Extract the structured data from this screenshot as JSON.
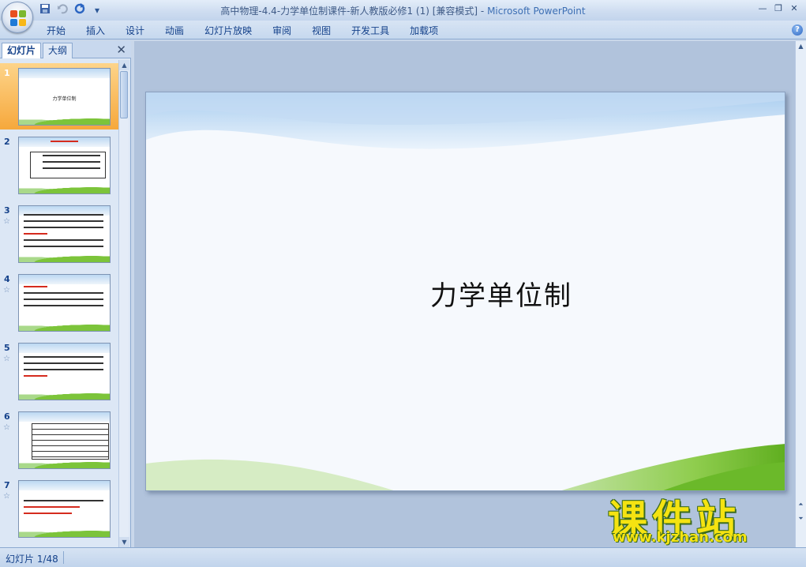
{
  "window": {
    "title": "高中物理-4.4-力学单位制课件-新人教版必修1 (1) [兼容模式]",
    "separator": " - ",
    "app_name": "Microsoft PowerPoint",
    "controls": [
      "—",
      "❐",
      "✕"
    ]
  },
  "quick_access": [
    "save-icon",
    "undo-icon",
    "redo-icon",
    "customize-icon"
  ],
  "ribbon_tabs": [
    "开始",
    "插入",
    "设计",
    "动画",
    "幻灯片放映",
    "审阅",
    "视图",
    "开发工具",
    "加载项"
  ],
  "help": "?",
  "left_panel": {
    "tabs": [
      "幻灯片",
      "大纲"
    ],
    "close": "✕",
    "thumbnails": [
      {
        "num": "1",
        "title": "力学单位制",
        "selected": true,
        "star": ""
      },
      {
        "num": "2",
        "title": "",
        "selected": false,
        "star": ""
      },
      {
        "num": "3",
        "title": "",
        "selected": false,
        "star": "☆"
      },
      {
        "num": "4",
        "title": "",
        "selected": false,
        "star": "☆"
      },
      {
        "num": "5",
        "title": "",
        "selected": false,
        "star": "☆"
      },
      {
        "num": "6",
        "title": "",
        "selected": false,
        "star": "☆"
      },
      {
        "num": "7",
        "title": "",
        "selected": false,
        "star": "☆"
      }
    ]
  },
  "slide": {
    "title": "力学单位制"
  },
  "watermark": {
    "cn": "课件站",
    "url": "www.kjzhan.com"
  },
  "status": {
    "slide_position": "幻灯片 1/48"
  },
  "colors": {
    "ribbon_text": "#15428b",
    "selected_thumb": "#f6a83c",
    "grass": "#7cc43a"
  }
}
